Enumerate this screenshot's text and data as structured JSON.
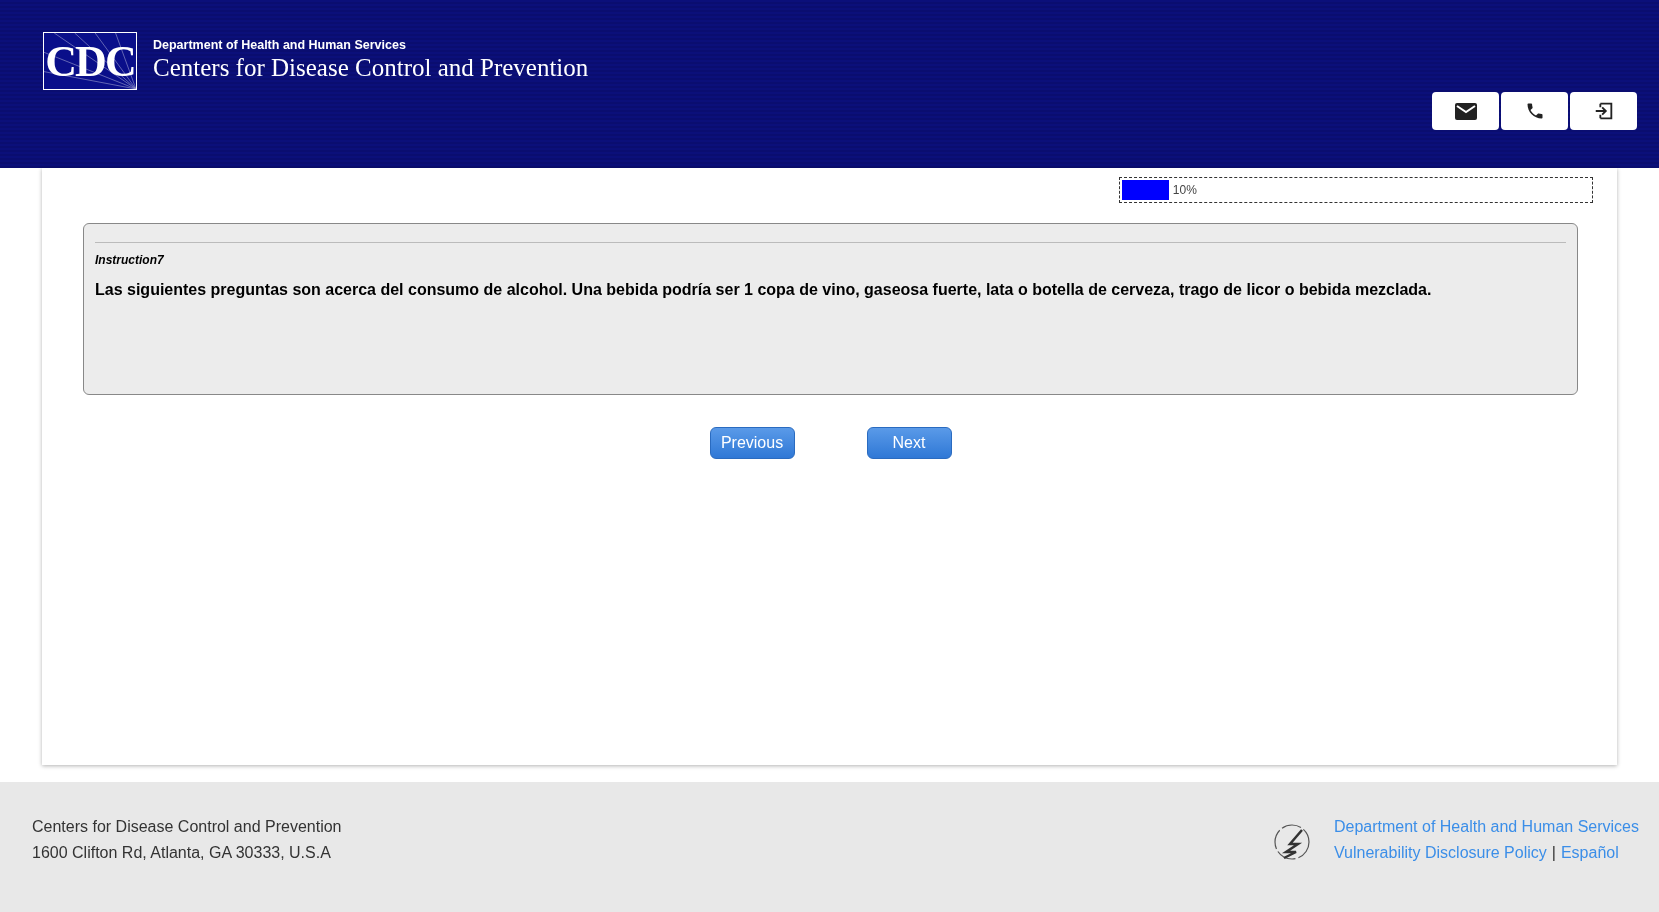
{
  "header": {
    "logo_text": "CDC",
    "department": "Department of Health and Human Services",
    "agency": "Centers for Disease Control and Prevention"
  },
  "progress": {
    "level": 0.1,
    "reading": "10%"
  },
  "instruction": {
    "label": "Instruction7",
    "text": "Las siguientes preguntas son acerca del consumo de alcohol. Una bebida podría ser 1 copa de vino, gaseosa fuerte, lata o botella de cerveza, trago de licor o bebida mezclada."
  },
  "buttons": [
    "Previous",
    "Next"
  ],
  "footer": {
    "address": [
      "Centers for Disease Control and Prevention",
      "1600 Clifton Rd, Atlanta, GA 30333, U.S.A"
    ],
    "links": [
      "Department of Health and Human Services",
      "Vulnerability Disclosure Policy",
      "Español"
    ],
    "separator": "|"
  }
}
